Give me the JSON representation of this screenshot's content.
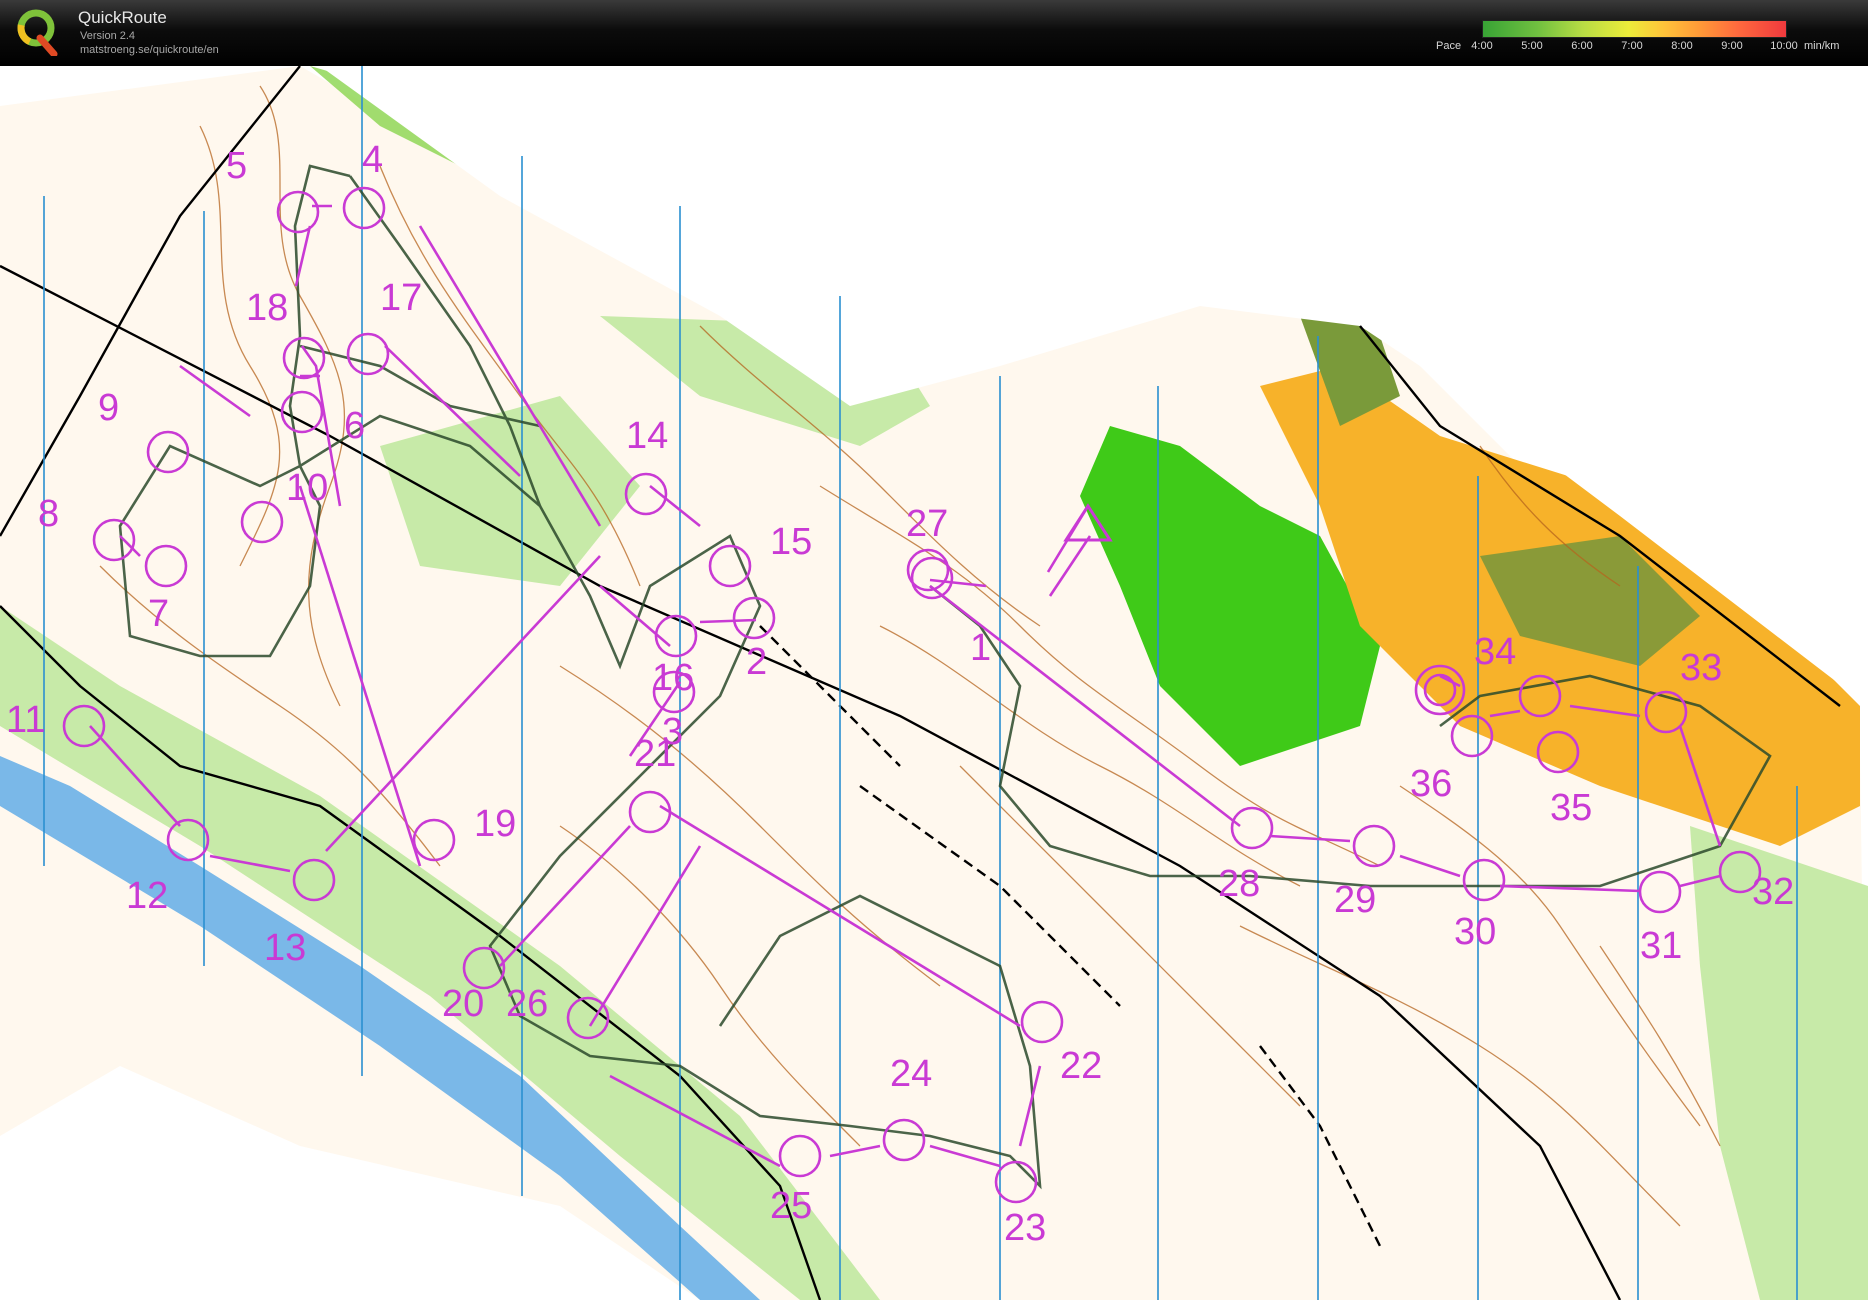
{
  "app": {
    "title": "QuickRoute",
    "version": "Version 2.4",
    "url": "matstroeng.se/quickroute/en",
    "logo_icon": "quickroute-q-logo-icon"
  },
  "pace_legend": {
    "label": "Pace",
    "ticks": [
      "4:00",
      "5:00",
      "6:00",
      "7:00",
      "8:00",
      "9:00",
      "10:00"
    ],
    "unit": "min/km",
    "colors": [
      "#38a335",
      "#70c040",
      "#b8dc44",
      "#ecec3a",
      "#ffc23a",
      "#ff9838",
      "#ff6a3e",
      "#f03a3e"
    ]
  },
  "map": {
    "course_color": "#c93ad4",
    "route_color": "#2b4a2b",
    "contour_color": "#b5641e",
    "north_line_color": "#2a8fd0",
    "water_color": "#7ab8e8",
    "vegetation_light": "#c7eaa8",
    "vegetation_dark": "#7ccc4c",
    "open_land": "#f7b22a",
    "controls": [
      "1",
      "2",
      "3",
      "4",
      "5",
      "6",
      "7",
      "8",
      "9",
      "10",
      "11",
      "12",
      "13",
      "14",
      "15",
      "16",
      "17",
      "18",
      "19",
      "20",
      "21",
      "22",
      "23",
      "24",
      "25",
      "26",
      "27",
      "28",
      "29",
      "30",
      "31",
      "32",
      "33",
      "34",
      "35",
      "36"
    ]
  }
}
